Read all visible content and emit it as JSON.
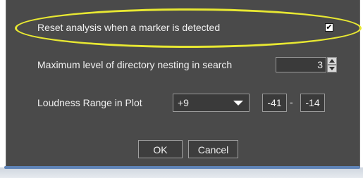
{
  "options": {
    "reset_analysis": {
      "label": "Reset analysis when a marker is detected",
      "checked": true,
      "check_mark": "✔"
    },
    "max_nesting": {
      "label": "Maximum level of directory nesting in search",
      "value": "3"
    },
    "loudness_range": {
      "label": "Loudness Range in Plot",
      "selected": "+9",
      "low": "-41",
      "separator": "-",
      "high": "-14"
    }
  },
  "buttons": {
    "ok": "OK",
    "cancel": "Cancel"
  },
  "colors": {
    "panel_bg": "#4a4a4a",
    "highlight": "#e8e832",
    "text": "#f0f0f0"
  }
}
